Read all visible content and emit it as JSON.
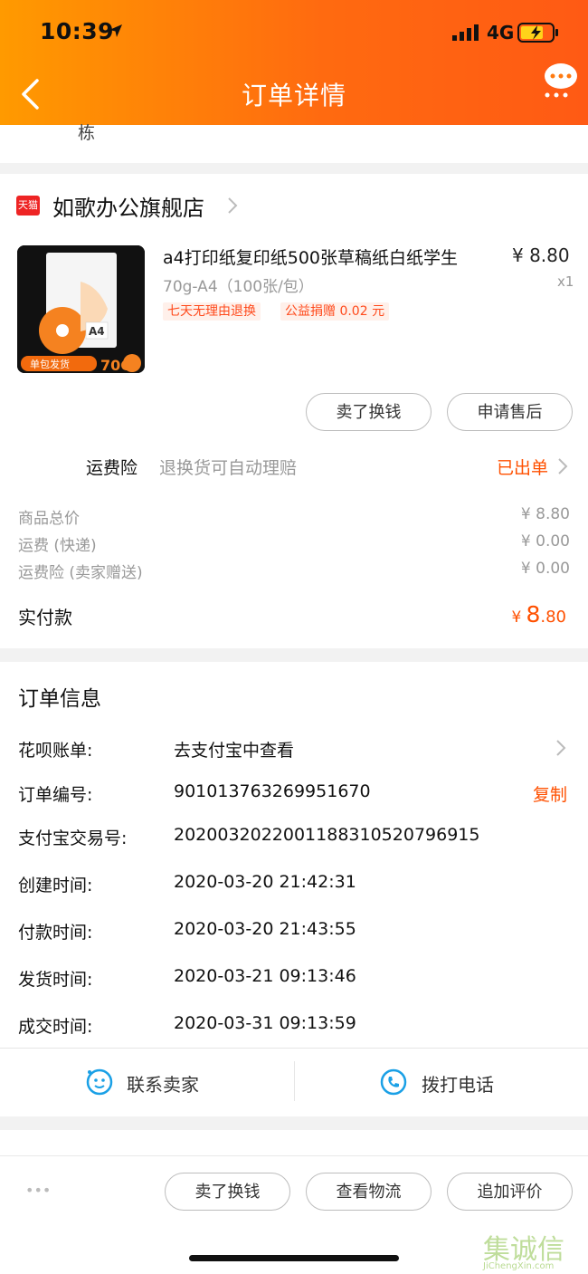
{
  "status_bar": {
    "time": "10:39",
    "network": "4G"
  },
  "header": {
    "title": "订单详情"
  },
  "top_remnant_text": "栋",
  "store": {
    "badge": "天猫",
    "name": "如歌办公旗舰店"
  },
  "product": {
    "name": "a4打印纸复印纸500张草稿纸白纸学生",
    "price": "¥ 8.80",
    "quantity": "x1",
    "spec": "70g-A4（100张/包）",
    "tags": [
      "七天无理由退换",
      "公益捐赠 0.02 元"
    ],
    "thumb_banner": "单包发货",
    "thumb_weight": "70G",
    "thumb_size": "A4"
  },
  "product_actions": [
    "卖了换钱",
    "申请售后"
  ],
  "insurance": {
    "label": "运费险",
    "desc": "退换货可自动理赔",
    "status": "已出单"
  },
  "price_rows": [
    {
      "label": "商品总价",
      "value": "¥ 8.80"
    },
    {
      "label": "运费 (快递)",
      "value": "¥ 0.00"
    },
    {
      "label": "运费险 (卖家赠送)",
      "value": "¥ 0.00"
    }
  ],
  "paid": {
    "label": "实付款",
    "currency": "¥",
    "int": "8",
    "dec": ".80"
  },
  "order_info": {
    "heading": "订单信息",
    "rows": [
      {
        "label": "花呗账单:",
        "value": "去支付宝中查看"
      },
      {
        "label": "订单编号:",
        "value": "901013763269951670",
        "action": "复制"
      },
      {
        "label": "支付宝交易号:",
        "value": "2020032022001188310520796915"
      },
      {
        "label": "创建时间:",
        "value": "2020-03-20 21:42:31"
      },
      {
        "label": "付款时间:",
        "value": "2020-03-20 21:43:55"
      },
      {
        "label": "发货时间:",
        "value": "2020-03-21 09:13:46"
      },
      {
        "label": "成交时间:",
        "value": "2020-03-31 09:13:59"
      }
    ]
  },
  "contact": {
    "seller": "联系卖家",
    "phone": "拨打电话"
  },
  "bottom_actions": [
    "卖了换钱",
    "查看物流",
    "追加评价"
  ],
  "more_dots": "•••",
  "watermark": {
    "text": "集诚信",
    "url": "JiChengXin.com"
  },
  "colors": {
    "accent": "#ff5000",
    "header_start": "#ff9a00",
    "header_end": "#ff5a14"
  }
}
